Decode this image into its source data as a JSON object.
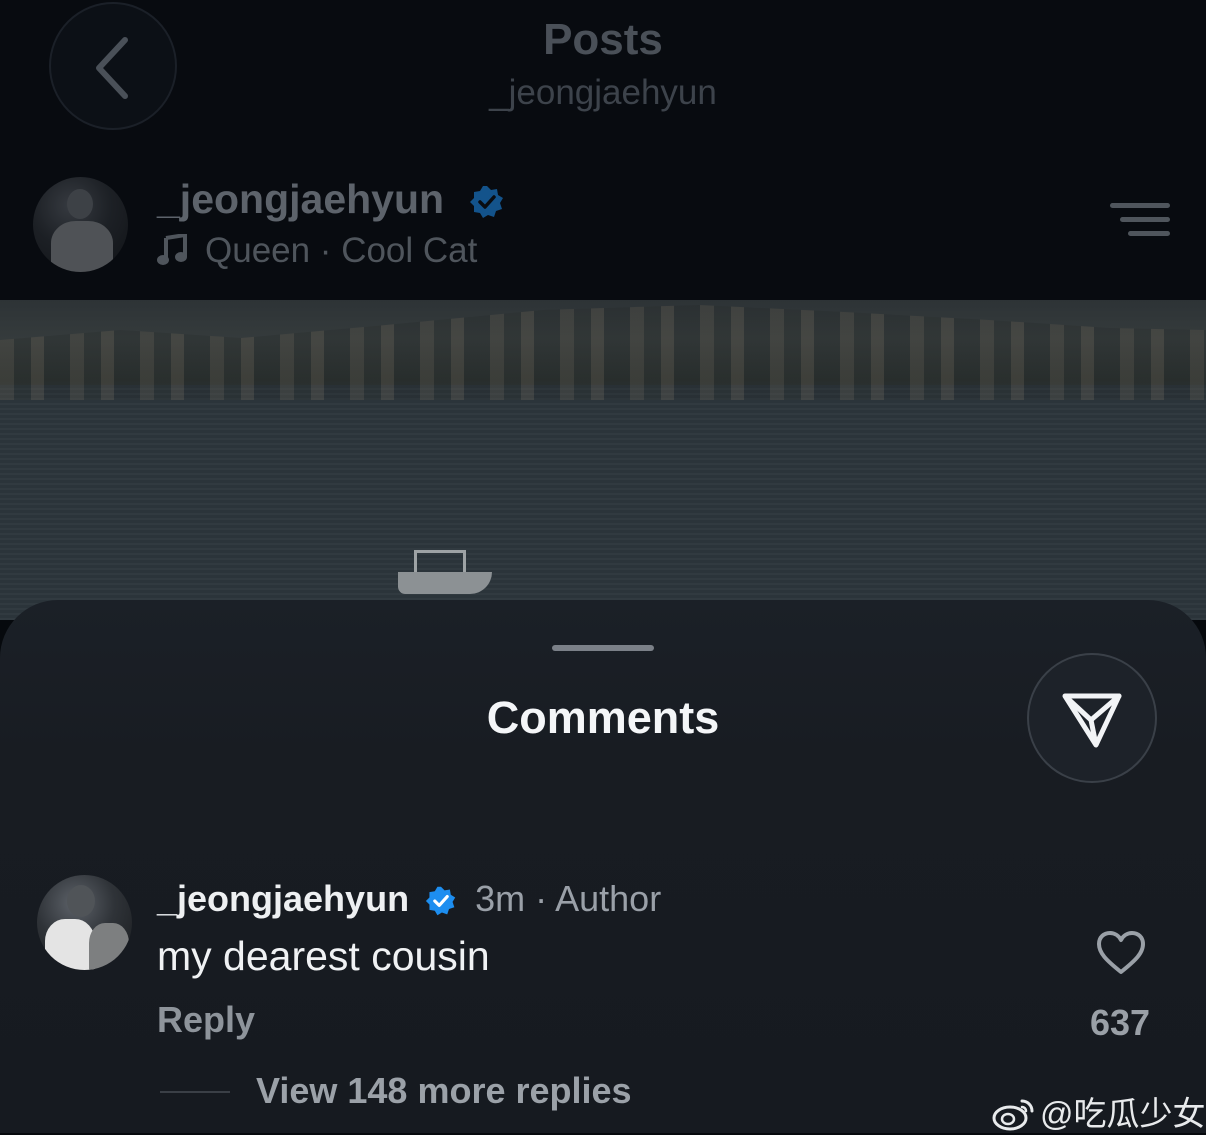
{
  "header": {
    "title": "Posts",
    "subtitle": "_jeongjaehyun"
  },
  "post": {
    "username": "_jeongjaehyun",
    "music": "Queen · Cool Cat"
  },
  "comments_sheet": {
    "title": "Comments",
    "comment": {
      "username": "_jeongjaehyun",
      "meta": "3m · Author",
      "text": "my dearest cousin",
      "reply_label": "Reply",
      "like_count": "637",
      "view_replies": "View 148 more replies"
    }
  },
  "watermark": "@吃瓜少女",
  "colors": {
    "verified": "#1d8ef0",
    "sheet_bg": "#181c22",
    "header_bg": "#080b10"
  },
  "icons": [
    "back-chevron-icon",
    "verified-badge-icon",
    "music-note-icon",
    "menu-icon",
    "share-send-icon",
    "heart-icon",
    "weibo-icon"
  ]
}
